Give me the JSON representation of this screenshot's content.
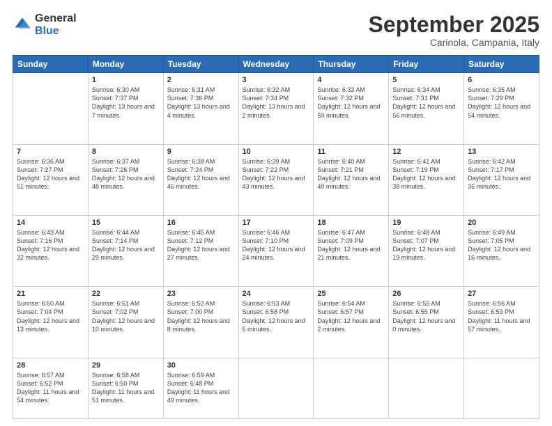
{
  "logo": {
    "general": "General",
    "blue": "Blue"
  },
  "header": {
    "month": "September 2025",
    "location": "Carinola, Campania, Italy"
  },
  "weekdays": [
    "Sunday",
    "Monday",
    "Tuesday",
    "Wednesday",
    "Thursday",
    "Friday",
    "Saturday"
  ],
  "weeks": [
    [
      {
        "day": "",
        "sunrise": "",
        "sunset": "",
        "daylight": ""
      },
      {
        "day": "1",
        "sunrise": "Sunrise: 6:30 AM",
        "sunset": "Sunset: 7:37 PM",
        "daylight": "Daylight: 13 hours and 7 minutes."
      },
      {
        "day": "2",
        "sunrise": "Sunrise: 6:31 AM",
        "sunset": "Sunset: 7:36 PM",
        "daylight": "Daylight: 13 hours and 4 minutes."
      },
      {
        "day": "3",
        "sunrise": "Sunrise: 6:32 AM",
        "sunset": "Sunset: 7:34 PM",
        "daylight": "Daylight: 13 hours and 2 minutes."
      },
      {
        "day": "4",
        "sunrise": "Sunrise: 6:33 AM",
        "sunset": "Sunset: 7:32 PM",
        "daylight": "Daylight: 12 hours and 59 minutes."
      },
      {
        "day": "5",
        "sunrise": "Sunrise: 6:34 AM",
        "sunset": "Sunset: 7:31 PM",
        "daylight": "Daylight: 12 hours and 56 minutes."
      },
      {
        "day": "6",
        "sunrise": "Sunrise: 6:35 AM",
        "sunset": "Sunset: 7:29 PM",
        "daylight": "Daylight: 12 hours and 54 minutes."
      }
    ],
    [
      {
        "day": "7",
        "sunrise": "Sunrise: 6:36 AM",
        "sunset": "Sunset: 7:27 PM",
        "daylight": "Daylight: 12 hours and 51 minutes."
      },
      {
        "day": "8",
        "sunrise": "Sunrise: 6:37 AM",
        "sunset": "Sunset: 7:26 PM",
        "daylight": "Daylight: 12 hours and 48 minutes."
      },
      {
        "day": "9",
        "sunrise": "Sunrise: 6:38 AM",
        "sunset": "Sunset: 7:24 PM",
        "daylight": "Daylight: 12 hours and 46 minutes."
      },
      {
        "day": "10",
        "sunrise": "Sunrise: 6:39 AM",
        "sunset": "Sunset: 7:22 PM",
        "daylight": "Daylight: 12 hours and 43 minutes."
      },
      {
        "day": "11",
        "sunrise": "Sunrise: 6:40 AM",
        "sunset": "Sunset: 7:21 PM",
        "daylight": "Daylight: 12 hours and 40 minutes."
      },
      {
        "day": "12",
        "sunrise": "Sunrise: 6:41 AM",
        "sunset": "Sunset: 7:19 PM",
        "daylight": "Daylight: 12 hours and 38 minutes."
      },
      {
        "day": "13",
        "sunrise": "Sunrise: 6:42 AM",
        "sunset": "Sunset: 7:17 PM",
        "daylight": "Daylight: 12 hours and 35 minutes."
      }
    ],
    [
      {
        "day": "14",
        "sunrise": "Sunrise: 6:43 AM",
        "sunset": "Sunset: 7:16 PM",
        "daylight": "Daylight: 12 hours and 32 minutes."
      },
      {
        "day": "15",
        "sunrise": "Sunrise: 6:44 AM",
        "sunset": "Sunset: 7:14 PM",
        "daylight": "Daylight: 12 hours and 29 minutes."
      },
      {
        "day": "16",
        "sunrise": "Sunrise: 6:45 AM",
        "sunset": "Sunset: 7:12 PM",
        "daylight": "Daylight: 12 hours and 27 minutes."
      },
      {
        "day": "17",
        "sunrise": "Sunrise: 6:46 AM",
        "sunset": "Sunset: 7:10 PM",
        "daylight": "Daylight: 12 hours and 24 minutes."
      },
      {
        "day": "18",
        "sunrise": "Sunrise: 6:47 AM",
        "sunset": "Sunset: 7:09 PM",
        "daylight": "Daylight: 12 hours and 21 minutes."
      },
      {
        "day": "19",
        "sunrise": "Sunrise: 6:48 AM",
        "sunset": "Sunset: 7:07 PM",
        "daylight": "Daylight: 12 hours and 19 minutes."
      },
      {
        "day": "20",
        "sunrise": "Sunrise: 6:49 AM",
        "sunset": "Sunset: 7:05 PM",
        "daylight": "Daylight: 12 hours and 16 minutes."
      }
    ],
    [
      {
        "day": "21",
        "sunrise": "Sunrise: 6:50 AM",
        "sunset": "Sunset: 7:04 PM",
        "daylight": "Daylight: 12 hours and 13 minutes."
      },
      {
        "day": "22",
        "sunrise": "Sunrise: 6:51 AM",
        "sunset": "Sunset: 7:02 PM",
        "daylight": "Daylight: 12 hours and 10 minutes."
      },
      {
        "day": "23",
        "sunrise": "Sunrise: 6:52 AM",
        "sunset": "Sunset: 7:00 PM",
        "daylight": "Daylight: 12 hours and 8 minutes."
      },
      {
        "day": "24",
        "sunrise": "Sunrise: 6:53 AM",
        "sunset": "Sunset: 6:58 PM",
        "daylight": "Daylight: 12 hours and 5 minutes."
      },
      {
        "day": "25",
        "sunrise": "Sunrise: 6:54 AM",
        "sunset": "Sunset: 6:57 PM",
        "daylight": "Daylight: 12 hours and 2 minutes."
      },
      {
        "day": "26",
        "sunrise": "Sunrise: 6:55 AM",
        "sunset": "Sunset: 6:55 PM",
        "daylight": "Daylight: 12 hours and 0 minutes."
      },
      {
        "day": "27",
        "sunrise": "Sunrise: 6:56 AM",
        "sunset": "Sunset: 6:53 PM",
        "daylight": "Daylight: 11 hours and 57 minutes."
      }
    ],
    [
      {
        "day": "28",
        "sunrise": "Sunrise: 6:57 AM",
        "sunset": "Sunset: 6:52 PM",
        "daylight": "Daylight: 11 hours and 54 minutes."
      },
      {
        "day": "29",
        "sunrise": "Sunrise: 6:58 AM",
        "sunset": "Sunset: 6:50 PM",
        "daylight": "Daylight: 11 hours and 51 minutes."
      },
      {
        "day": "30",
        "sunrise": "Sunrise: 6:59 AM",
        "sunset": "Sunset: 6:48 PM",
        "daylight": "Daylight: 11 hours and 49 minutes."
      },
      {
        "day": "",
        "sunrise": "",
        "sunset": "",
        "daylight": ""
      },
      {
        "day": "",
        "sunrise": "",
        "sunset": "",
        "daylight": ""
      },
      {
        "day": "",
        "sunrise": "",
        "sunset": "",
        "daylight": ""
      },
      {
        "day": "",
        "sunrise": "",
        "sunset": "",
        "daylight": ""
      }
    ]
  ]
}
